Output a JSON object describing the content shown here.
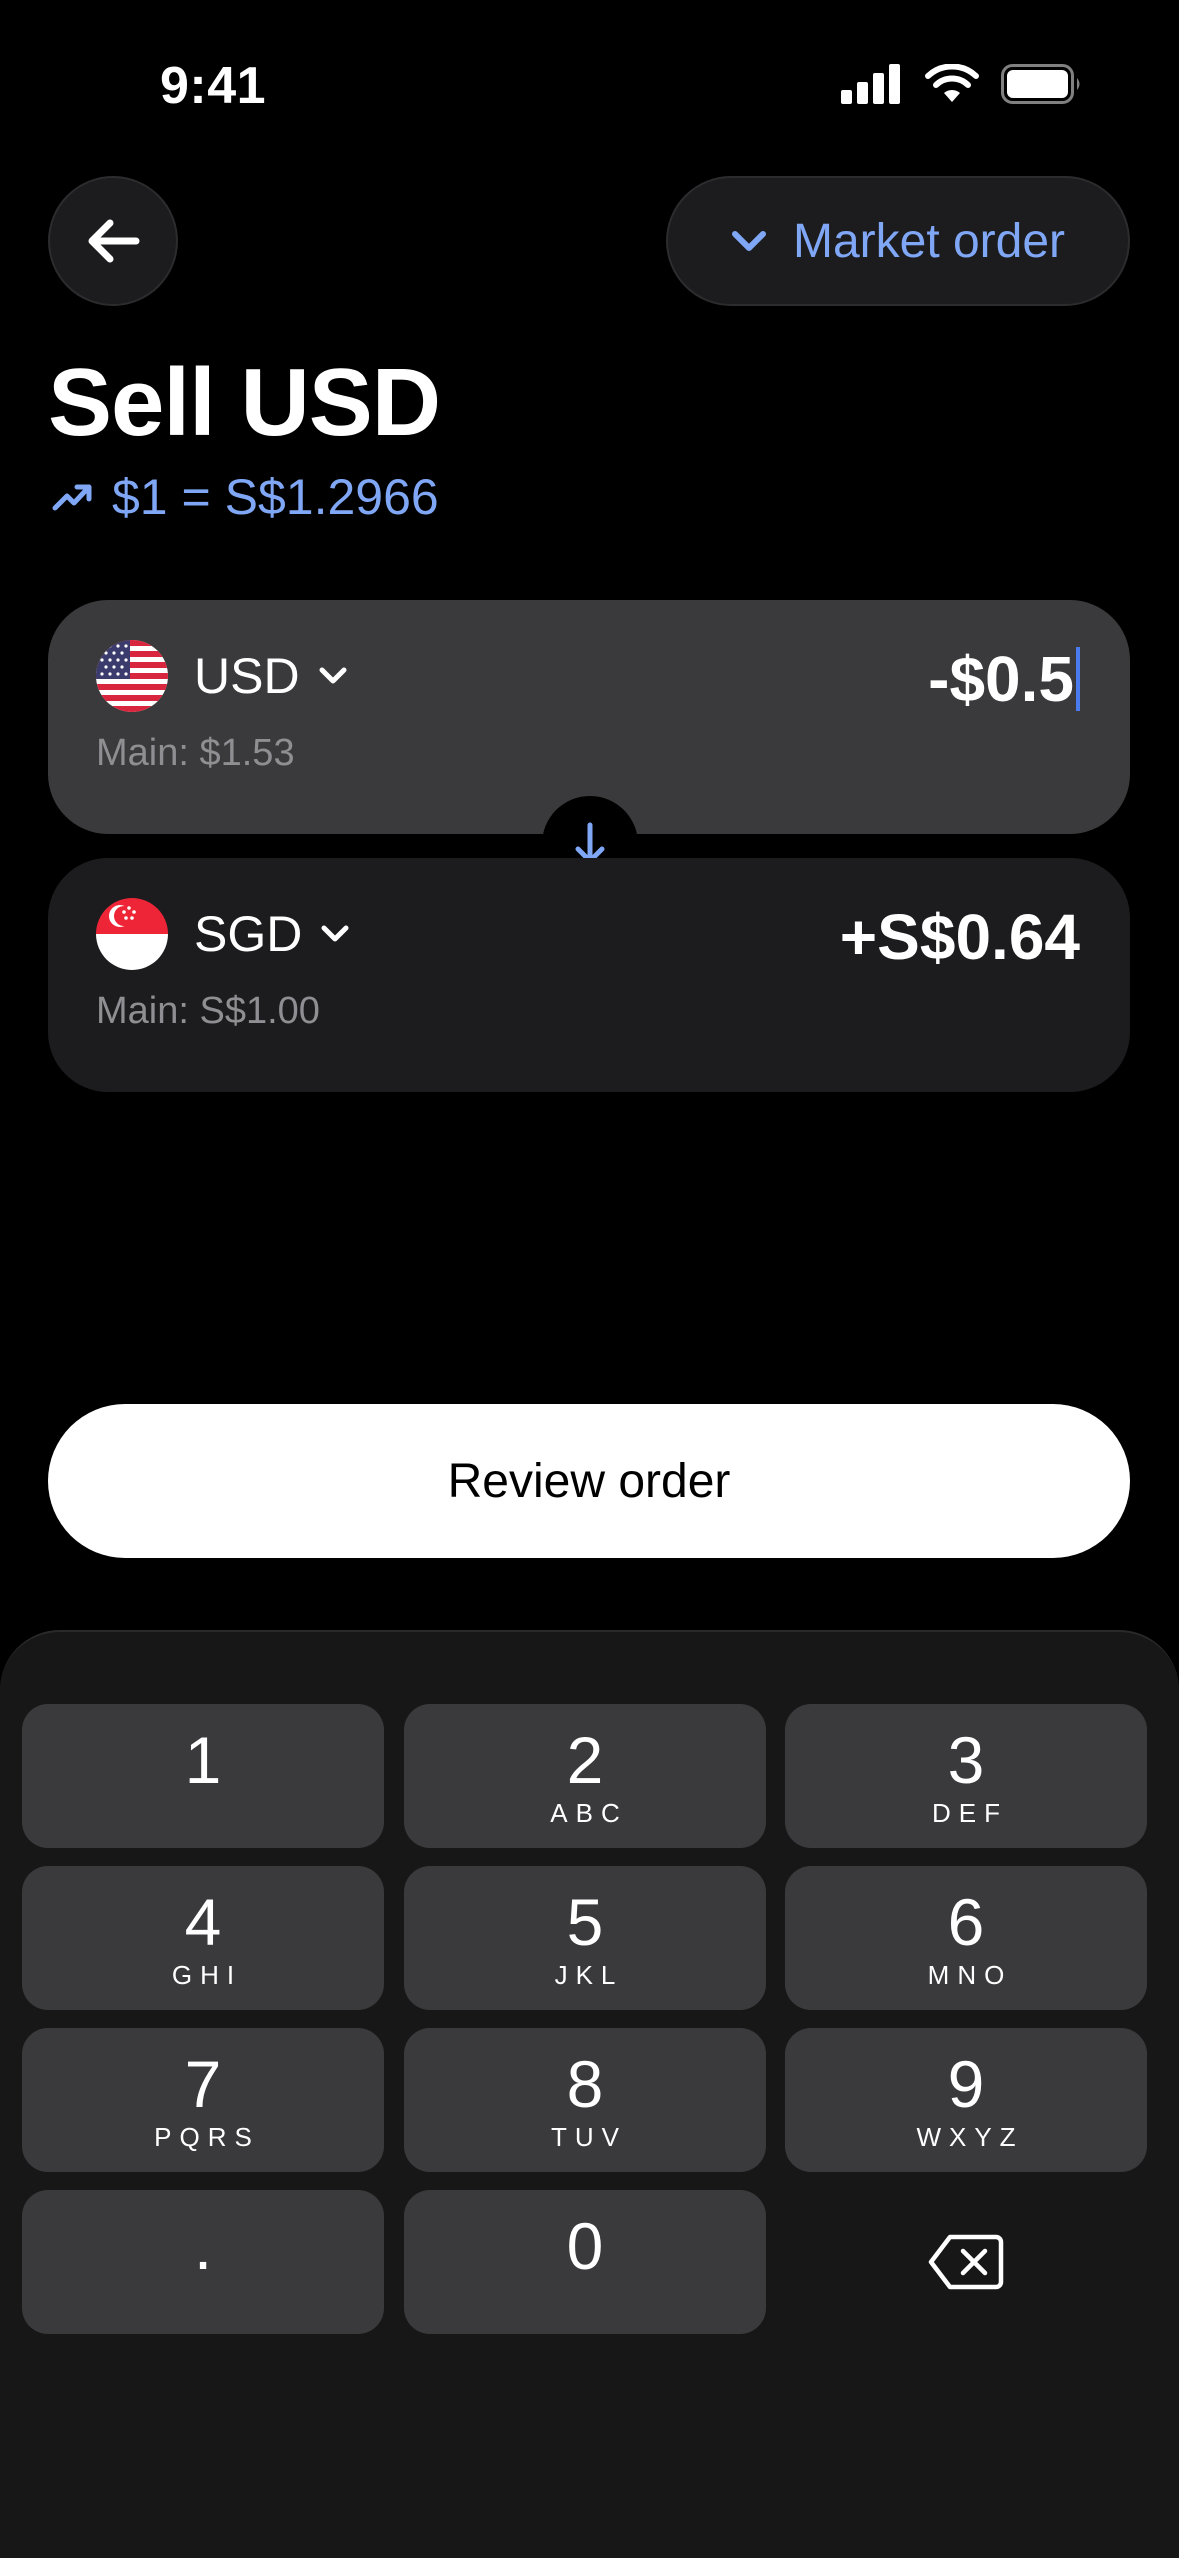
{
  "status_bar": {
    "time": "9:41"
  },
  "header": {
    "order_type": "Market order",
    "title": "Sell USD",
    "rate": "$1 = S$1.2966"
  },
  "from_card": {
    "currency": "USD",
    "balance": "Main: $1.53",
    "amount": "-$0.5"
  },
  "to_card": {
    "currency": "SGD",
    "balance": "Main: S$1.00",
    "amount": "+S$0.64"
  },
  "review_label": "Review order",
  "keys": [
    {
      "digit": "1",
      "letters": ""
    },
    {
      "digit": "2",
      "letters": "ABC"
    },
    {
      "digit": "3",
      "letters": "DEF"
    },
    {
      "digit": "4",
      "letters": "GHI"
    },
    {
      "digit": "5",
      "letters": "JKL"
    },
    {
      "digit": "6",
      "letters": "MNO"
    },
    {
      "digit": "7",
      "letters": "PQRS"
    },
    {
      "digit": "8",
      "letters": "TUV"
    },
    {
      "digit": "9",
      "letters": "WXYZ"
    },
    {
      "digit": ".",
      "letters": ""
    },
    {
      "digit": "0",
      "letters": ""
    }
  ],
  "icons": [
    "back-arrow-icon",
    "chevron-down-icon",
    "trending-up-icon",
    "us-flag-icon",
    "sg-flag-icon",
    "arrow-down-icon",
    "backspace-icon",
    "signal-icon",
    "wifi-icon",
    "battery-icon"
  ],
  "colors": {
    "accent": "#7fa7f5",
    "card_active": "#3a3a3c",
    "card_inactive": "#1c1c1e"
  }
}
